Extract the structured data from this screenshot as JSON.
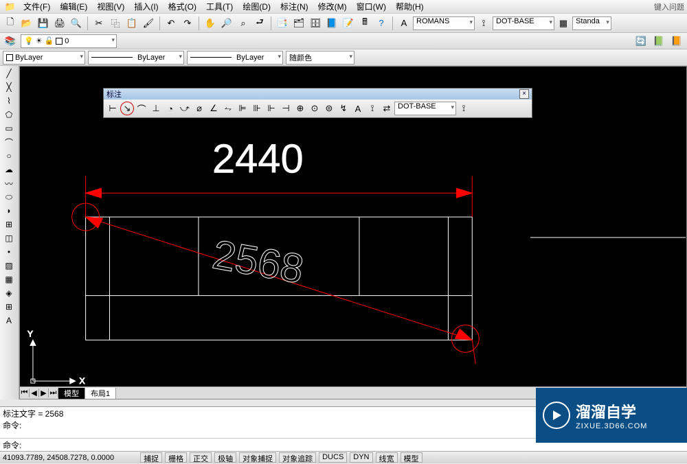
{
  "menu": {
    "items": [
      "文件(F)",
      "编辑(E)",
      "视图(V)",
      "插入(I)",
      "格式(O)",
      "工具(T)",
      "绘图(D)",
      "标注(N)",
      "修改(M)",
      "窗口(W)",
      "帮助(H)"
    ],
    "search_hint": "键入问题"
  },
  "toolbars": {
    "style_dd1": "ROMANS",
    "style_dd2": "DOT-BASE",
    "style_dd3": "Standa"
  },
  "layerbar": {
    "current": "0"
  },
  "props": {
    "color": "ByLayer",
    "ltype": "ByLayer",
    "lweight": "ByLayer",
    "plot": "随颜色"
  },
  "float": {
    "title": "标注",
    "dimstyle": "DOT-BASE"
  },
  "canvas": {
    "dim_horizontal": "2440",
    "dim_aligned": "2568",
    "axis_x": "X",
    "axis_y": "Y"
  },
  "tabs": {
    "model": "模型",
    "layout1": "布局1"
  },
  "cmd": {
    "line1": "标注文字 = 2568",
    "line2": "命令:",
    "prompt": "命令:"
  },
  "status": {
    "coords": "41093.7789, 24508.7278, 0.0000",
    "buttons": [
      "捕捉",
      "栅格",
      "正交",
      "极轴",
      "对象捕捉",
      "对象追踪",
      "DUCS",
      "DYN",
      "线宽",
      "模型"
    ]
  },
  "brand": {
    "name": "溜溜自学",
    "url": "ZIXUE.3D66.COM"
  }
}
